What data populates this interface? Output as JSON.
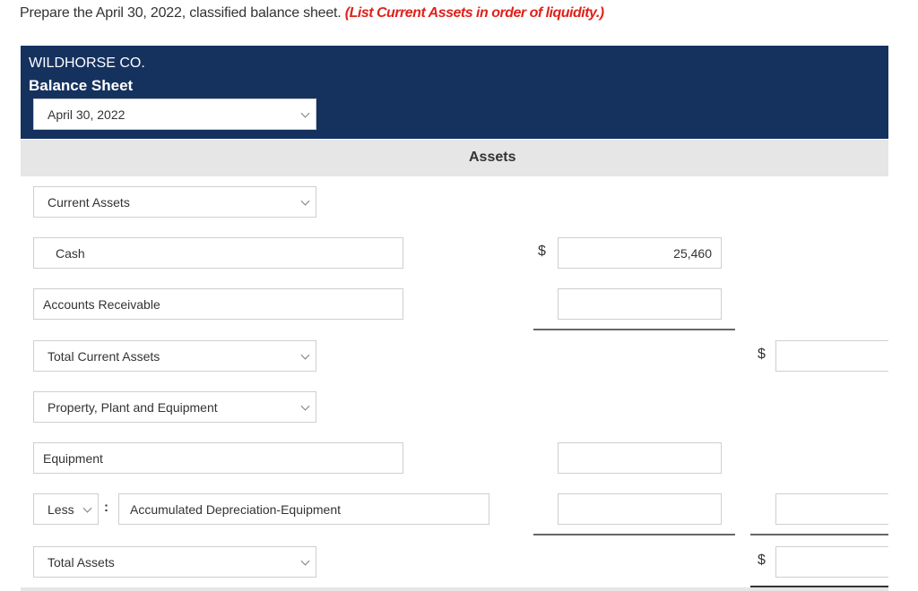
{
  "instruction": {
    "text": "Prepare the April 30, 2022, classified balance sheet.",
    "note": "(List Current Assets in order of liquidity.)"
  },
  "header": {
    "company": "WILDHORSE CO.",
    "title": "Balance Sheet",
    "date_select": "April 30, 2022"
  },
  "section": {
    "title": "Assets"
  },
  "rows": {
    "current_assets_heading": "Current Assets",
    "cash_label": "Cash",
    "cash_amount": "25,460",
    "accounts_receivable_label": "Accounts Receivable",
    "accounts_receivable_amount": "",
    "total_current_assets_label": "Total Current Assets",
    "total_current_assets_amount": "",
    "ppe_heading": "Property, Plant and Equipment",
    "equipment_label": "Equipment",
    "equipment_amount": "",
    "less_select": "Less",
    "colon": ":",
    "accum_dep_label": "Accumulated Depreciation-Equipment",
    "accum_dep_amount": "",
    "net_ppe_amount": "",
    "total_assets_label": "Total Assets",
    "total_assets_amount": ""
  },
  "currency_symbol": "$",
  "colors": {
    "header_bg": "#15325f",
    "band_bg": "#e6e6e6",
    "note_red": "#e0211b"
  }
}
